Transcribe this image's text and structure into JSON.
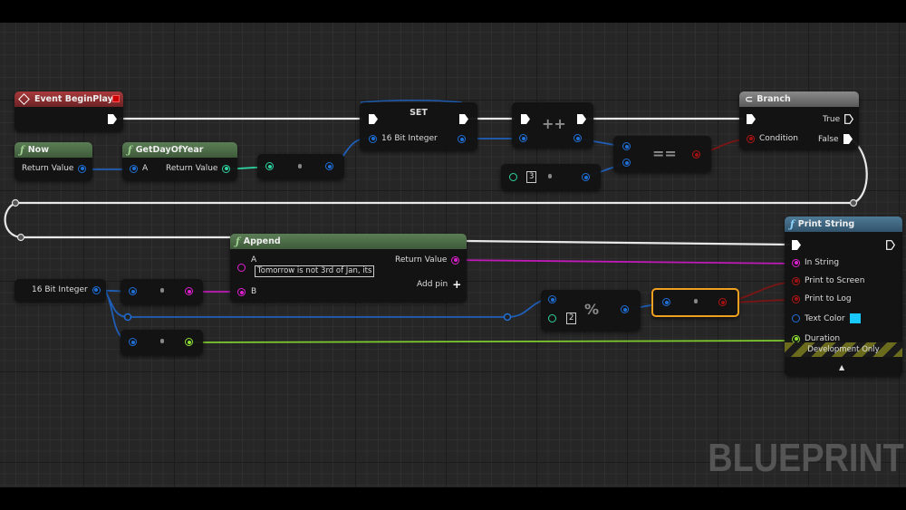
{
  "watermark": "BLUEPRINT",
  "nodes": {
    "event_begin_play": {
      "title": "Event BeginPlay"
    },
    "now": {
      "title": "Now",
      "return_label": "Return Value"
    },
    "get_day_of_year": {
      "title": "GetDayOfYear",
      "input_label": "A",
      "return_label": "Return Value"
    },
    "set": {
      "title": "SET",
      "var_label": "16 Bit Integer"
    },
    "increment": {
      "symbol": "++"
    },
    "equals": {
      "symbol": "==",
      "literal": "3"
    },
    "branch": {
      "title": "Branch",
      "true_label": "True",
      "false_label": "False",
      "condition_label": "Condition"
    },
    "append": {
      "title": "Append",
      "a_label": "A",
      "a_value": "Tomorrow is not 3rd of Jan, its",
      "b_label": "B",
      "return_label": "Return Value",
      "add_pin_label": "Add pin",
      "add_pin_symbol": "+"
    },
    "var_get": {
      "label": "16 Bit Integer"
    },
    "modulo": {
      "symbol": "%",
      "literal": "2"
    },
    "print_string": {
      "title": "Print String",
      "in_string": "In String",
      "print_to_screen": "Print to Screen",
      "print_to_log": "Print to Log",
      "text_color": "Text Color",
      "text_color_value": "#18c8ff",
      "duration": "Duration",
      "dev_only": "Development Only",
      "expand_symbol": "▲"
    }
  },
  "pin_colors": {
    "exec": "#ffffff",
    "integer": "#1f6fd6",
    "datetime": "#2fd4a0",
    "string": "#e020d0",
    "boolean": "#a01010",
    "float": "#8ee035"
  }
}
